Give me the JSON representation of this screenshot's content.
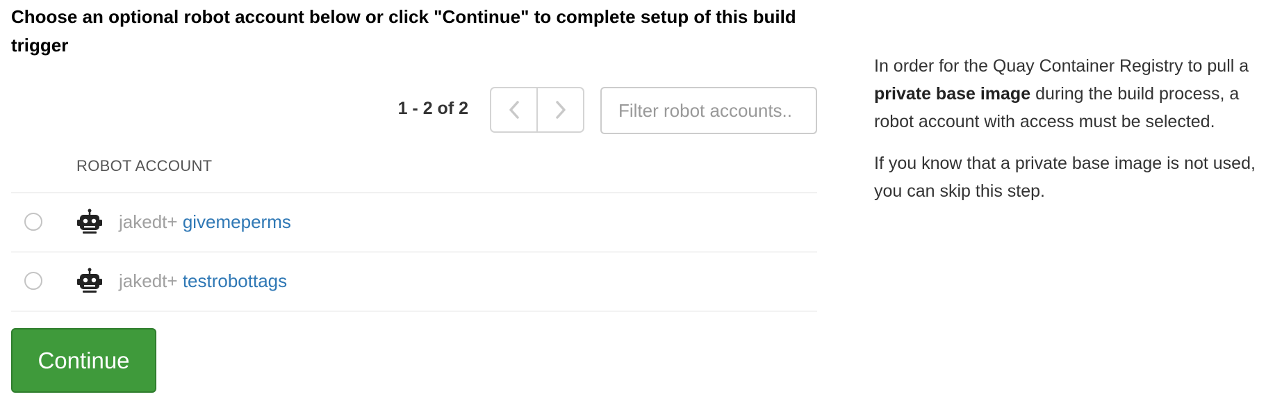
{
  "title": "Choose an optional robot account below or click \"Continue\" to complete setup of this build trigger",
  "pager": {
    "count_text": "1 - 2 of 2",
    "prev_icon": "chevron-left-icon",
    "next_icon": "chevron-right-icon"
  },
  "filter": {
    "placeholder": "Filter robot accounts..",
    "value": ""
  },
  "table": {
    "column_header": "ROBOT ACCOUNT",
    "rows": [
      {
        "prefix": "jakedt+",
        "short_name": "givemeperms",
        "icon": "robot-icon",
        "selected": false
      },
      {
        "prefix": "jakedt+",
        "short_name": "testrobottags",
        "icon": "robot-icon",
        "selected": false
      }
    ]
  },
  "continue_label": "Continue",
  "help": {
    "p1_before": "In order for the Quay Container Registry to pull a ",
    "p1_bold": "private base image",
    "p1_after": " during the build process, a robot account with access must be selected.",
    "p2": "If you know that a private base image is not used, you can skip this step."
  },
  "colors": {
    "accent_link": "#2f78b5",
    "continue_button": "#3f9a3b",
    "muted_text": "#a0a0a0"
  }
}
